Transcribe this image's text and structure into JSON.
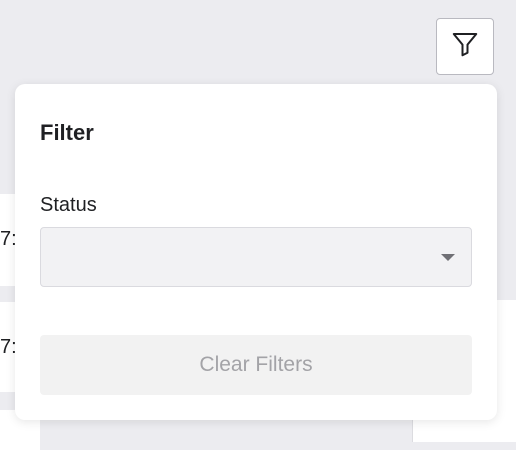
{
  "background": {
    "rows": [
      {
        "text": "7:"
      },
      {
        "text": "7:"
      }
    ]
  },
  "toolbar": {
    "filter_button_icon": "funnel-icon"
  },
  "filter_panel": {
    "title": "Filter",
    "status": {
      "label": "Status",
      "value": "",
      "caret_icon": "caret-down-icon"
    },
    "clear_button_label": "Clear Filters"
  },
  "colors": {
    "page_background": "#ececf0",
    "panel_background": "#ffffff",
    "select_background": "#f2f2f4",
    "disabled_button_background": "#f2f2f2",
    "disabled_text": "#a3a3a7"
  }
}
